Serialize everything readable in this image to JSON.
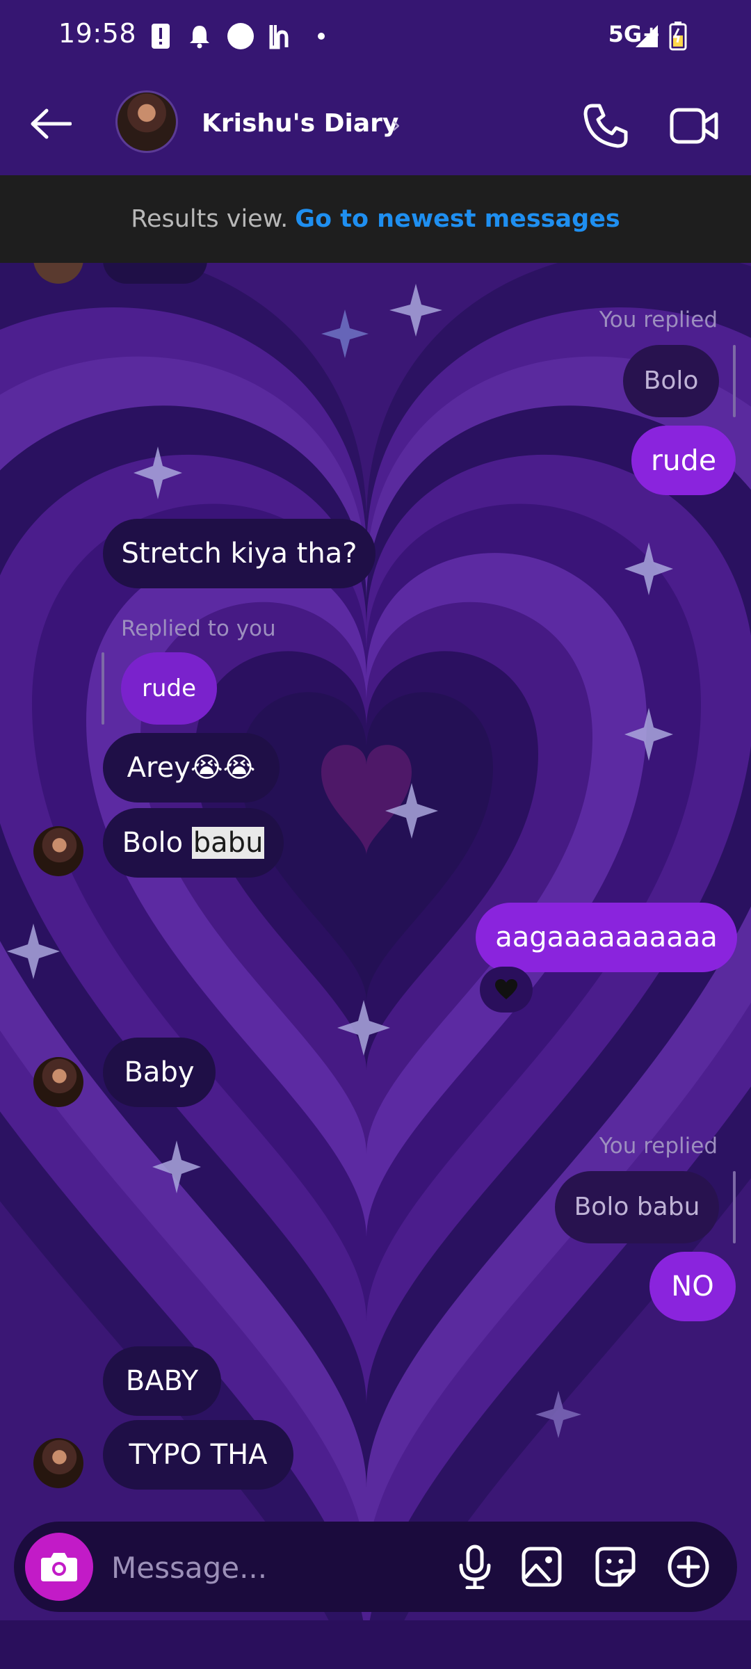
{
  "status_bar": {
    "time": "19:58",
    "network": "5G+"
  },
  "header": {
    "title": "Krishu's Diary",
    "chevron": "›"
  },
  "banner": {
    "text": "Results view.",
    "link": "Go to newest messages"
  },
  "messages": {
    "you_replied_1": "You replied",
    "quote_bolo": "Bolo",
    "out_rude": "rude",
    "in_stretch": "Stretch kiya tha?",
    "replied_to_you": "Replied to you",
    "quote_rude": "rude",
    "in_arey": "Arey😭😭",
    "in_bolo_prefix": "Bolo ",
    "in_bolo_highlight": "babu",
    "out_aagaa": "aagaaaaaaaaaa",
    "in_baby": "Baby",
    "you_replied_2": "You replied",
    "quote_bolo_babu": "Bolo babu",
    "out_no": "NO",
    "in_baby_caps": "BABY",
    "in_typo": "TYPO THA"
  },
  "composer": {
    "placeholder": "Message..."
  },
  "colors": {
    "header_bg": "#361672",
    "banner_bg": "#1e1e1e",
    "link": "#1f8ff0",
    "incoming_bubble": "#1f0f47",
    "outgoing_bubble": "#8a24dd",
    "camera_button": "#c21bc7"
  },
  "icons": {
    "back": "arrow-left-icon",
    "call": "phone-icon",
    "video": "video-camera-icon",
    "camera": "camera-icon",
    "mic": "microphone-icon",
    "gallery": "image-icon",
    "sticker": "sticker-icon",
    "more": "plus-circle-icon",
    "reaction": "heart-icon"
  }
}
